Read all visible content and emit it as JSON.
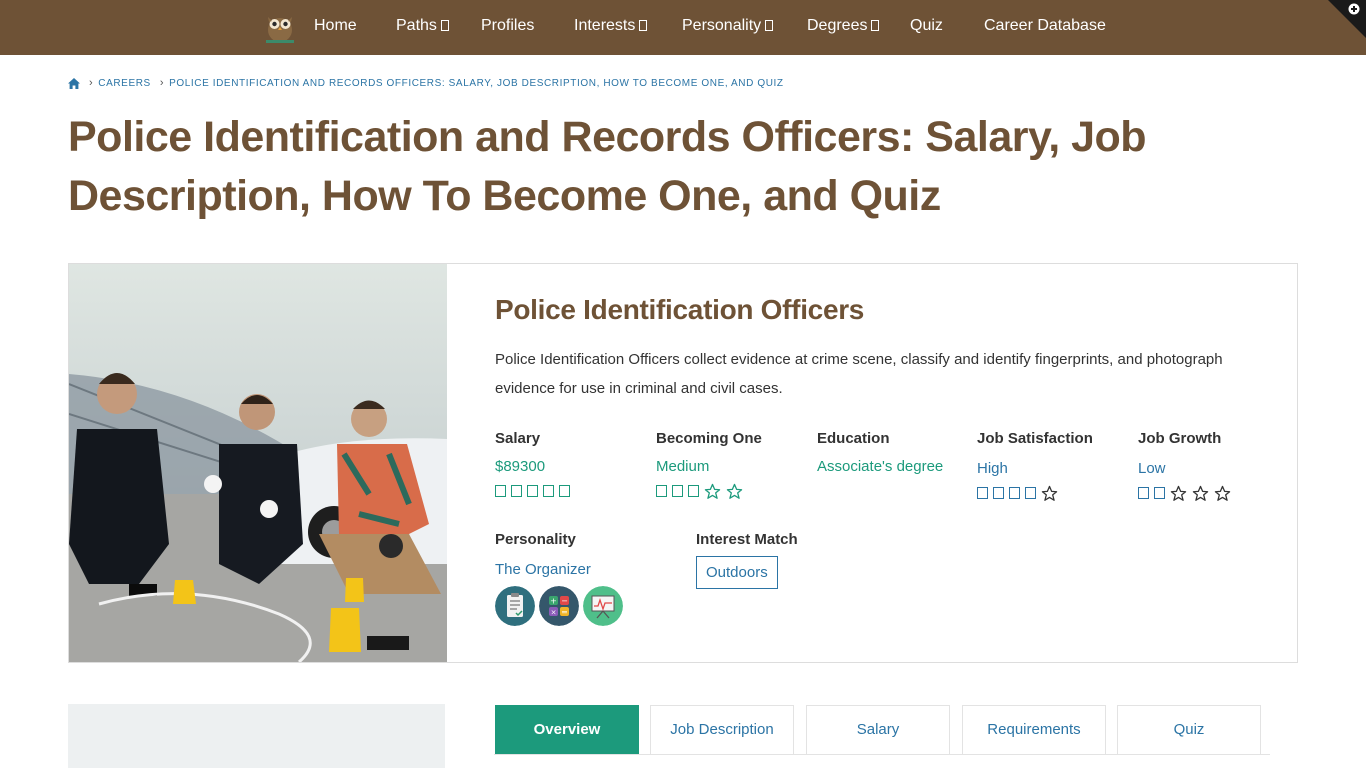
{
  "nav": {
    "items": [
      {
        "label": "Home",
        "has_caret": false
      },
      {
        "label": "Paths",
        "has_caret": true
      },
      {
        "label": "Profiles",
        "has_caret": false
      },
      {
        "label": "Interests",
        "has_caret": true
      },
      {
        "label": "Personality",
        "has_caret": true
      },
      {
        "label": "Degrees",
        "has_caret": true
      },
      {
        "label": "Quiz",
        "has_caret": false
      },
      {
        "label": "Career Database",
        "has_caret": false
      }
    ],
    "logo_icon": "owl-logo-icon",
    "bg_color": "#6e5236"
  },
  "breadcrumb": {
    "home_icon": "home-icon",
    "items": [
      "CAREERS",
      "POLICE IDENTIFICATION AND RECORDS OFFICERS: SALARY, JOB DESCRIPTION, HOW TO BECOME ONE, AND QUIZ"
    ]
  },
  "page": {
    "title": "Police Identification and Records Officers: Salary, Job Description, How To Become One, and Quiz"
  },
  "career": {
    "title": "Police Identification Officers",
    "description": "Police Identification Officers collect evidence at crime scene, classify and identify fingerprints, and photograph evidence for use in criminal and civil cases.",
    "stats": {
      "salary": {
        "label": "Salary",
        "value": "$89300",
        "rating": 5,
        "max": 5
      },
      "becoming": {
        "label": "Becoming One",
        "value": "Medium",
        "rating": 3,
        "max": 5
      },
      "education": {
        "label": "Education",
        "value": "Associate's degree"
      },
      "satisfaction": {
        "label": "Job Satisfaction",
        "value": "High",
        "rating": 4,
        "max": 5
      },
      "growth": {
        "label": "Job Growth",
        "value": "Low",
        "rating": 2,
        "max": 5
      }
    },
    "personality": {
      "label": "Personality",
      "value": "The Organizer",
      "icons": [
        "clipboard-icon",
        "calculator-icon",
        "presentation-icon"
      ]
    },
    "interest": {
      "label": "Interest Match",
      "value": "Outdoors"
    }
  },
  "tabs": [
    "Overview",
    "Job Description",
    "Salary",
    "Requirements",
    "Quiz"
  ],
  "colors": {
    "brown": "#6e5236",
    "green": "#1c9a7c",
    "blue": "#2b74a5"
  }
}
